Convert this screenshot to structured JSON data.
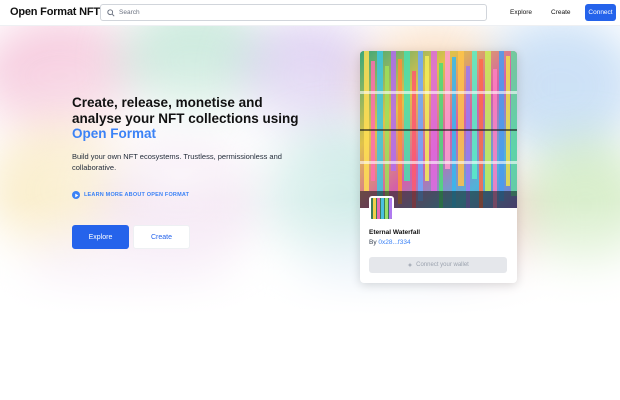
{
  "header": {
    "brand": "Open Format NFT",
    "search_placeholder": "Search",
    "nav_explore": "Explore",
    "nav_create": "Create",
    "connect": "Connect"
  },
  "hero": {
    "headline_main": "Create, release, monetise and analyse your NFT collections using ",
    "headline_accent": "Open Format",
    "subtitle": "Build your own NFT ecosystems. Trustless, permissionless and collaborative.",
    "learn_more": "LEARN MORE ABOUT OPEN FORMAT",
    "explore_button": "Explore",
    "create_button": "Create"
  },
  "card": {
    "title": "Eternal Waterfall",
    "by_prefix": "By ",
    "address": "0x28...f334",
    "connect_button": "Connect your wallet"
  },
  "colors": {
    "accent": "#2563eb",
    "link": "#3b82f6"
  },
  "icons": [
    "search-icon",
    "play-circle-icon",
    "wallet-icon"
  ]
}
